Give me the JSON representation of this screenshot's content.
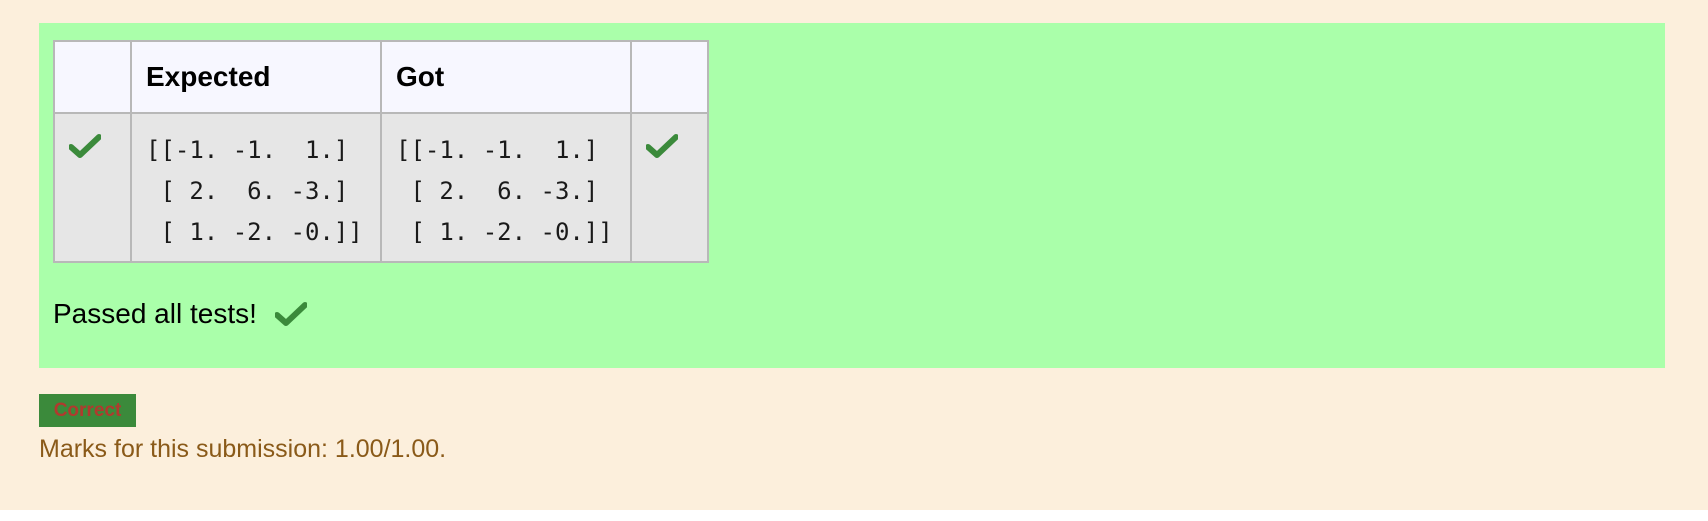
{
  "results_table": {
    "headers": [
      "",
      "Expected",
      "Got",
      ""
    ],
    "rows": [
      {
        "expected": "[[-1. -1.  1.]\n [ 2.  6. -3.]\n [ 1. -2. -0.]]",
        "got": "[[-1. -1.  1.]\n [ 2.  6. -3.]\n [ 1. -2. -0.]]"
      }
    ]
  },
  "summary": {
    "passed_text": "Passed all tests!"
  },
  "grade": {
    "badge_label": "Correct",
    "marks_text": "Marks for this submission: 1.00/1.00."
  },
  "colors": {
    "page_bg": "#fcefdc",
    "results_bg": "#aaffaa",
    "tick": "#3b8a3b",
    "badge_bg": "#3b8a3b",
    "marks_text": "#8a5a19"
  },
  "icons": {
    "row_status_left": "check-icon",
    "row_status_right": "check-icon",
    "summary_status": "check-icon"
  }
}
